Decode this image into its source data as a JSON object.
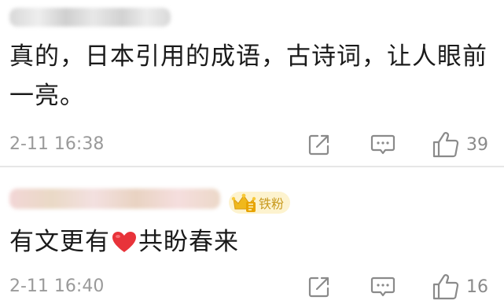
{
  "comments": [
    {
      "text": "真的，日本引用的成语，古诗词，让人眼前一亮。",
      "timestamp": "2-11 16:38",
      "likes": "39"
    },
    {
      "badge": "铁粉",
      "text_before": "有文更有",
      "text_after": "共盼春来",
      "timestamp": "2-11 16:40",
      "likes": "16"
    }
  ],
  "icons": {
    "share": "share-icon",
    "comment": "comment-icon",
    "like": "thumbs-up-icon",
    "heart": "heart-emoji-icon",
    "crown": "crown-icon"
  },
  "colors": {
    "badge_text": "#c89a1e",
    "badge_bg": "#fdf3cf",
    "heart": "#e8333a",
    "meta_text": "#9a9a9a"
  }
}
